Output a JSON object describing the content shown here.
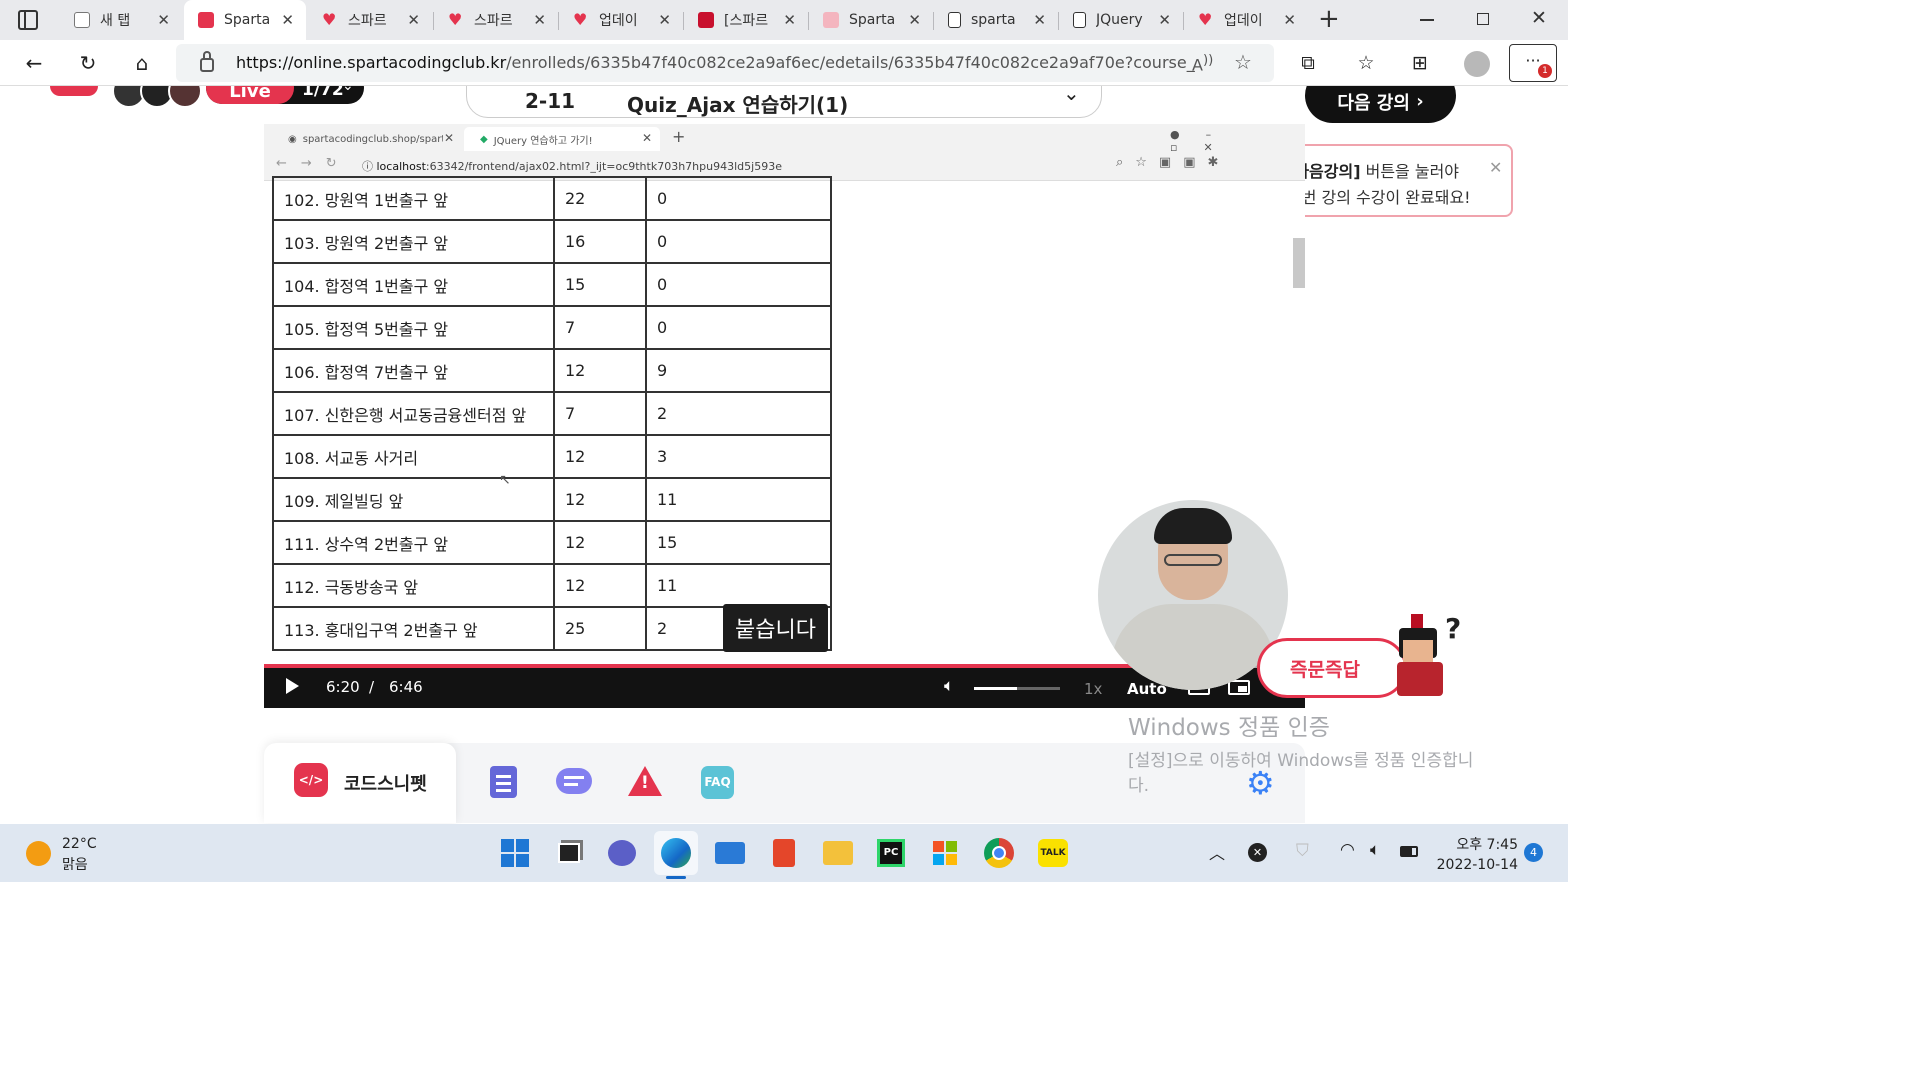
{
  "browser": {
    "tabs": [
      {
        "title": "새 탭",
        "icon": "new-tab-icon",
        "active": false
      },
      {
        "title": "Sparta",
        "icon": "sparta-favicon-icon",
        "active": true
      },
      {
        "title": "스파르",
        "icon": "sparta-heart-icon",
        "active": false
      },
      {
        "title": "스파르",
        "icon": "sparta-heart-icon",
        "active": false
      },
      {
        "title": "업데이",
        "icon": "sparta-heart-icon",
        "active": false
      },
      {
        "title": "[스파르",
        "icon": "book-icon",
        "active": false
      },
      {
        "title": "Sparta",
        "icon": "sparta-favicon-icon",
        "active": false
      },
      {
        "title": "sparta",
        "icon": "document-icon",
        "active": false
      },
      {
        "title": "JQuery",
        "icon": "document-icon",
        "active": false
      },
      {
        "title": "업데이",
        "icon": "sparta-heart-icon",
        "active": false
      }
    ],
    "url_host": "https://online.spartacodingclub.kr",
    "url_path": "/enrolleds/6335b47f40c082ce2a9af6ec/edetails/6335b47f40c082ce2a9af70e?course_id=6...",
    "menu_badge": "1"
  },
  "page": {
    "live_label": "Live",
    "live_count": "1/72",
    "lecture_number": "2-11",
    "lecture_title": "Quiz_Ajax 연습하기(1)",
    "next_button": "다음 강의",
    "tooltip_bold": "[다음강의]",
    "tooltip_line1": " 버튼을 눌러야",
    "tooltip_line2": "이번 강의 수강이 완료돼요!",
    "question_button": "즉문즉답",
    "panel_items": [
      {
        "label": "코드스니펫",
        "icon": "code-snippet-icon"
      },
      {
        "label": "",
        "icon": "checklist-icon"
      },
      {
        "label": "",
        "icon": "chat-bubble-icon"
      },
      {
        "label": "",
        "icon": "warning-icon"
      },
      {
        "label": "FAQ",
        "icon": "faq-icon"
      }
    ],
    "watermark_title": "Windows 정품 인증",
    "watermark_line1": "[설정]으로 이동하여 Windows를 정품 인증합니",
    "watermark_line2": "다."
  },
  "video": {
    "inner_tabs": [
      "spartacodingclub.shop/sparta_a",
      "JQuery 연습하고 가기!"
    ],
    "inner_url_host": "localhost",
    "inner_url_rest": ":63342/frontend/ajax02.html?_ijt=oc9thtk703h7hpu943ld5j593e",
    "rows": [
      [
        "102. 망원역 1번출구 앞",
        "22",
        "0"
      ],
      [
        "103. 망원역 2번출구 앞",
        "16",
        "0"
      ],
      [
        "104. 합정역 1번출구 앞",
        "15",
        "0"
      ],
      [
        "105. 합정역 5번출구 앞",
        "7",
        "0"
      ],
      [
        "106. 합정역 7번출구 앞",
        "12",
        "9"
      ],
      [
        "107. 신한은행 서교동금융센터점 앞",
        "7",
        "2"
      ],
      [
        "108. 서교동 사거리",
        "12",
        "3"
      ],
      [
        "109. 제일빌딩 앞",
        "12",
        "11"
      ],
      [
        "111. 상수역 2번출구 앞",
        "12",
        "15"
      ],
      [
        "112. 극동방송국 앞",
        "12",
        "11"
      ],
      [
        "113. 홍대입구역 2번출구 앞",
        "25",
        "2"
      ]
    ],
    "subtitle": "붙습니다",
    "current_time": "6:20",
    "time_separator": "/",
    "duration": "6:46",
    "progress": 0.936,
    "volume": 0.5,
    "speed": "1x",
    "quality": "Auto"
  },
  "taskbar": {
    "weather_temp": "22°C",
    "weather_desc": "맑음",
    "clock_time": "오후 7:45",
    "clock_date": "2022-10-14",
    "notification_count": "4",
    "apps": [
      "windows-start-icon",
      "task-view-icon",
      "chat-icon",
      "edge-icon",
      "mail-icon",
      "office-icon",
      "file-explorer-icon",
      "pycharm-icon",
      "store-icon",
      "chrome-icon",
      "kakaotalk-icon"
    ]
  }
}
